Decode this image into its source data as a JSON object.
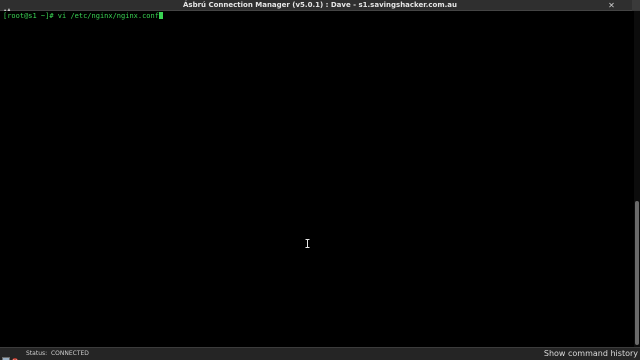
{
  "window": {
    "title": "Ásbrú Connection Manager (v5.0.1) : Dave - s1.savingshacker.com.au",
    "close_glyph": "✕"
  },
  "terminal": {
    "prompt": "[root@s1 ~]# ",
    "command": "vi /etc/nginx/nginx.conf",
    "text_color": "#39d353",
    "background": "#000000"
  },
  "statusbar": {
    "status_label": "Status:",
    "status_value": "CONNECTED",
    "history_button": "Show command history"
  },
  "icons": {
    "app": "asbru-app-icon",
    "close": "close-icon",
    "status": "connection-status-icon",
    "mouse": "text-cursor-icon"
  }
}
